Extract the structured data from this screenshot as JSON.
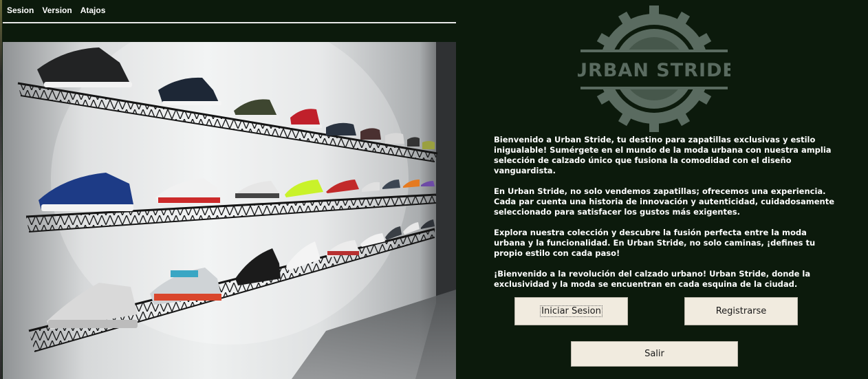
{
  "menu": {
    "items": [
      {
        "label": "Sesion"
      },
      {
        "label": "Version"
      },
      {
        "label": "Atajos"
      }
    ]
  },
  "logo": {
    "text": "URBAN STRIDE"
  },
  "welcome": {
    "paragraphs": [
      "Bienvenido a Urban Stride, tu destino para zapatillas exclusivas y estilo inigualable! Sumérgete en el mundo de la moda urbana con nuestra amplia selección de calzado único que fusiona la comodidad con el diseño vanguardista.",
      "En Urban Stride, no solo vendemos zapatillas; ofrecemos una experiencia. Cada par cuenta una historia de innovación y autenticidad, cuidadosamente seleccionado para satisfacer los gustos más exigentes.",
      "Explora nuestra colección y descubre la fusión perfecta entre la moda urbana y la funcionalidad. En Urban Stride, no solo caminas, ¡defines tu propio estilo con cada paso!",
      "¡Bienvenido a la revolución del calzado urbano! Urban Stride, donde la exclusividad y la moda se encuentran en cada esquina de la ciudad."
    ]
  },
  "buttons": {
    "login": "Iniciar Sesion",
    "register": "Registrarse",
    "exit": "Salir"
  },
  "colors": {
    "background": "#0c1a0c",
    "button_bg": "#f1ebdf",
    "logo": "#5a6b60",
    "text": "#ffffff"
  }
}
